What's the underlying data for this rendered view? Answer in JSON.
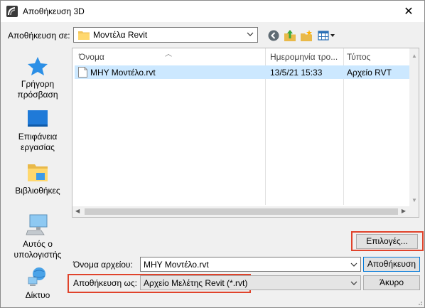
{
  "window": {
    "title": "Αποθήκευση 3D"
  },
  "location": {
    "label": "Αποθήκευση σε:",
    "value": "Μοντέλα Revit"
  },
  "toolbar": {
    "icons": [
      "back-icon",
      "up-folder-icon",
      "new-folder-icon",
      "view-menu-icon"
    ]
  },
  "places": [
    {
      "label": "Γρήγορη\nπρόσβαση",
      "icon": "star-icon"
    },
    {
      "label": "Επιφάνεια\nεργασίας",
      "icon": "desktop-icon"
    },
    {
      "label": "Βιβλιοθήκες",
      "icon": "libraries-icon"
    },
    {
      "label": "Αυτός ο\nυπολογιστής",
      "icon": "computer-icon"
    },
    {
      "label": "Δίκτυο",
      "icon": "network-icon"
    }
  ],
  "list": {
    "columns": [
      "Όνομα",
      "Ημερομηνία τρο...",
      "Τύπος"
    ],
    "rows": [
      {
        "name": "ΜΗΥ Μοντέλο.rvt",
        "date": "13/5/21 15:33",
        "type": "Αρχείο RVT"
      }
    ]
  },
  "options": {
    "label": "Επιλογές..."
  },
  "filename": {
    "label": "Όνομα αρχείου:",
    "value": "ΜΗΥ Μοντέλο.rvt"
  },
  "filetype": {
    "label": "Αποθήκευση ως:",
    "value": "Αρχείο Μελέτης Revit (*.rvt)"
  },
  "buttons": {
    "save": "Αποθήκευση",
    "cancel": "Άκυρο"
  },
  "colors": {
    "selection": "#cce8ff",
    "highlight_box": "#e0432b",
    "accent": "#0078d7"
  }
}
